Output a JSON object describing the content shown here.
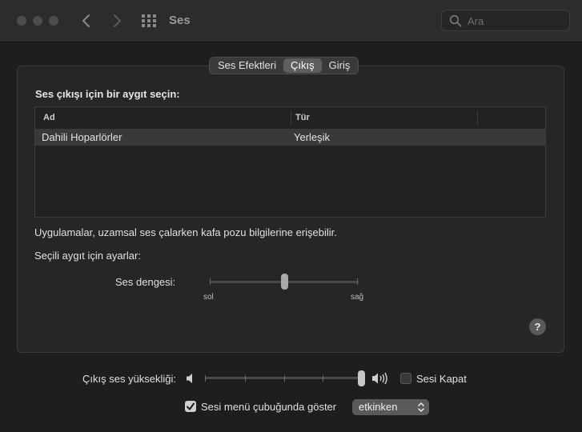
{
  "window": {
    "title": "Ses",
    "search": {
      "placeholder": "Ara",
      "value": ""
    }
  },
  "tabs": [
    {
      "label": "Ses Efektleri",
      "active": false
    },
    {
      "label": "Çıkış",
      "active": true
    },
    {
      "label": "Giriş",
      "active": false
    }
  ],
  "output": {
    "heading": "Ses çıkışı için bir aygıt seçin:",
    "columns": [
      "Ad",
      "Tür"
    ],
    "rows": [
      {
        "name": "Dahili Hoparlörler",
        "type": "Yerleşik",
        "selected": true
      }
    ],
    "note": "Uygulamalar, uzamsal ses çalarken kafa pozu bilgilerine erişebilir.",
    "settings_label": "Seçili aygıt için ayarlar:",
    "balance": {
      "label": "Ses dengesi:",
      "left_label": "sol",
      "right_label": "sağ",
      "value": 0.5
    },
    "help_label": "?"
  },
  "bottom": {
    "volume_label": "Çıkış ses yüksekliği:",
    "volume_value": 1.0,
    "mute": {
      "label": "Sesi Kapat",
      "checked": false
    },
    "show_in_menu": {
      "label": "Sesi menü çubuğunda göster",
      "checked": true
    },
    "show_mode": {
      "selected": "etkinken"
    }
  },
  "colors": {
    "background": "#1e1e1e",
    "panel": "#262626",
    "selected_row": "#393939"
  },
  "icons": [
    "back-icon",
    "forward-icon",
    "grid-icon",
    "search-icon",
    "speaker-low-icon",
    "speaker-high-icon",
    "help-icon",
    "checkmark-icon",
    "updown-arrows-icon"
  ]
}
